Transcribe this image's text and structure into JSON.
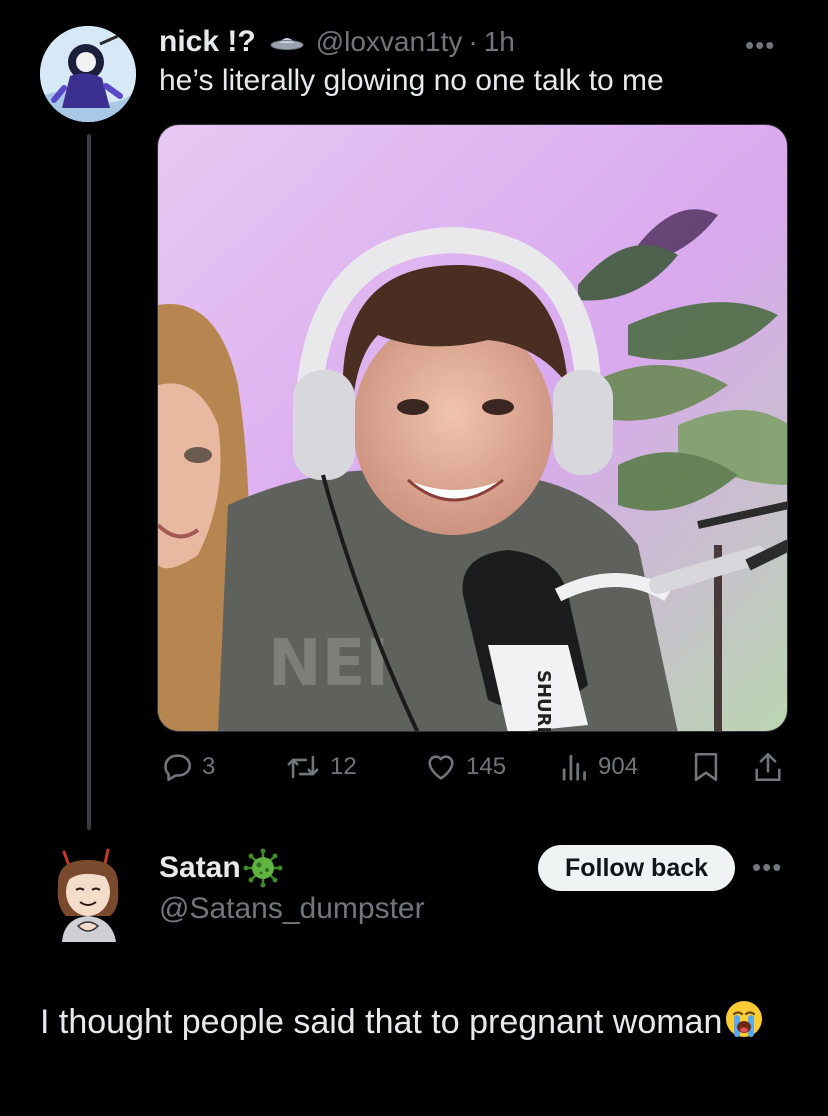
{
  "parent_tweet": {
    "display_name": "nick !?",
    "handle": "@loxvan1ty",
    "separator": "·",
    "time": "1h",
    "more_icon": "more-horizontal-icon",
    "text": "he’s literally glowing no one talk to me",
    "stats": {
      "replies": "3",
      "reposts": "12",
      "likes": "145",
      "views": "904"
    }
  },
  "reply_tweet": {
    "display_name": "Satan",
    "handle": "@Satans_dumpster",
    "follow_label": "Follow back",
    "more_icon": "more-horizontal-icon",
    "text": "I thought people said that to pregnant woman"
  },
  "colors": {
    "background": "#000000",
    "primary_text": "#e7e9ea",
    "secondary_text": "#71767b",
    "thread_line": "#3a3d41",
    "button_bg": "#eff3f4"
  }
}
